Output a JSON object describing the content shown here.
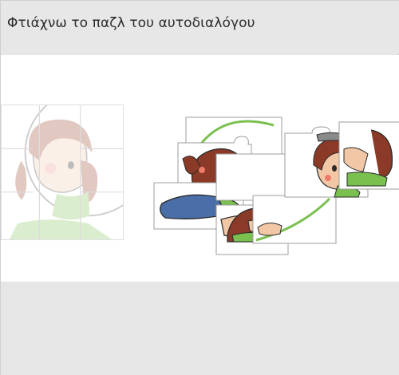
{
  "header": {
    "title": "Φτιάχνω το παζλ του αυτοδιαλόγου"
  },
  "puzzle": {
    "reference_image": "girl-thinking-illustration",
    "pieces": [
      {
        "id": "piece-1",
        "depicts": "girl-hair-and-back"
      },
      {
        "id": "piece-2",
        "depicts": "girl-face-left"
      },
      {
        "id": "piece-3",
        "depicts": "girl-body-lying"
      },
      {
        "id": "piece-4",
        "depicts": "girl-hair-top"
      },
      {
        "id": "piece-5",
        "depicts": "girl-hand-and-cheek"
      },
      {
        "id": "piece-6",
        "depicts": "girl-face-right"
      },
      {
        "id": "piece-7",
        "depicts": "legs-blue-jeans"
      },
      {
        "id": "piece-8",
        "depicts": "arms-green-shirt"
      },
      {
        "id": "piece-9",
        "depicts": "curve-background"
      }
    ]
  },
  "colors": {
    "hair": "#8a3a26",
    "skin": "#f1c7a6",
    "shirt": "#7ac04f",
    "jeans": "#4a6ea8",
    "outline": "#2a2a2a",
    "piece_border": "#9c9c9c"
  }
}
